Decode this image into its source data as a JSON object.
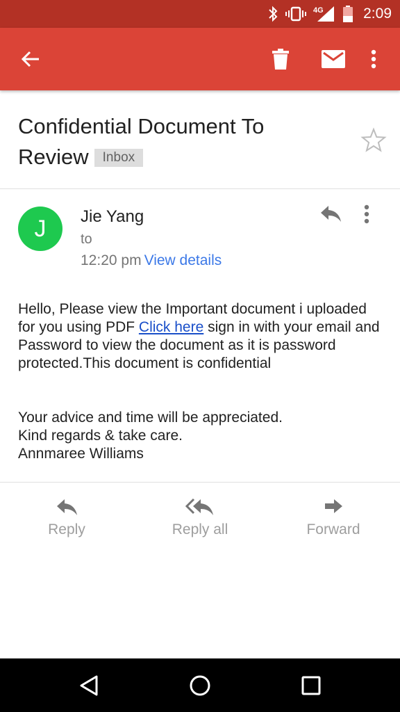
{
  "status_bar": {
    "time": "2:09",
    "network": "4G",
    "icons": [
      "bluetooth-icon",
      "vibrate-icon",
      "signal-icon",
      "battery-icon"
    ]
  },
  "app_bar": {
    "color": "#db4437",
    "icons": [
      "back-arrow-icon",
      "trash-icon",
      "mail-icon",
      "more-vert-icon"
    ]
  },
  "email": {
    "subject": "Confidential Document To Review",
    "label": "Inbox",
    "sender": {
      "initial": "J",
      "avatar_color": "#1ec94f",
      "name": "Jie Yang",
      "to": "to",
      "time": "12:20 pm",
      "view_details": "View details"
    },
    "body": {
      "p1_before_link": "Hello, Please view the Important document i uploaded for you using PDF ",
      "link": "Click here",
      "p1_after_link": " sign in with your email and Password to view the document as it is password protected.This document is confidential",
      "line2": "Your advice and time will be appreciated.",
      "line3": "Kind regards & take care.",
      "line4": "Annmaree Williams"
    }
  },
  "actions": {
    "reply": "Reply",
    "reply_all": "Reply all",
    "forward": "Forward"
  },
  "nav_bar": {
    "icons": [
      "nav-back-icon",
      "nav-home-icon",
      "nav-recents-icon"
    ]
  }
}
